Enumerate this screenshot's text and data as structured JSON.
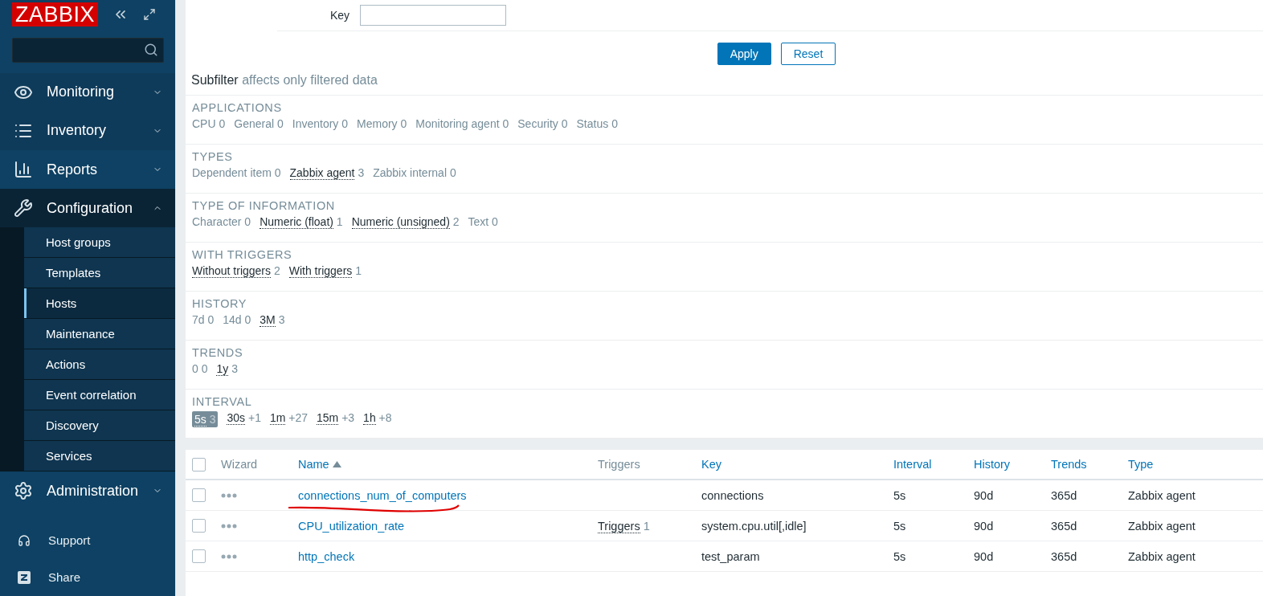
{
  "sidebar": {
    "logo": "ZABBIX",
    "menu": [
      {
        "label": "Monitoring",
        "expanded": false
      },
      {
        "label": "Inventory",
        "expanded": false
      },
      {
        "label": "Reports",
        "expanded": false
      },
      {
        "label": "Configuration",
        "expanded": true,
        "children": [
          {
            "label": "Host groups",
            "selected": false
          },
          {
            "label": "Templates",
            "selected": false
          },
          {
            "label": "Hosts",
            "selected": true
          },
          {
            "label": "Maintenance",
            "selected": false
          },
          {
            "label": "Actions",
            "selected": false
          },
          {
            "label": "Event correlation",
            "selected": false
          },
          {
            "label": "Discovery",
            "selected": false
          },
          {
            "label": "Services",
            "selected": false
          }
        ]
      },
      {
        "label": "Administration",
        "expanded": false
      }
    ],
    "footer": [
      {
        "label": "Support"
      },
      {
        "label": "Share"
      }
    ]
  },
  "filter": {
    "key_label": "Key",
    "buttons": [
      {
        "label": "Apply",
        "kind": "primary"
      },
      {
        "label": "Reset",
        "kind": "secondary"
      }
    ]
  },
  "subfilter": {
    "title": "Subfilter",
    "note": "affects only filtered data",
    "groups": [
      {
        "title": "APPLICATIONS",
        "items": [
          {
            "label": "CPU",
            "count": "0",
            "kind": "plain"
          },
          {
            "label": "General",
            "count": "0",
            "kind": "plain"
          },
          {
            "label": "Inventory",
            "count": "0",
            "kind": "plain"
          },
          {
            "label": "Memory",
            "count": "0",
            "kind": "plain"
          },
          {
            "label": "Monitoring agent",
            "count": "0",
            "kind": "plain"
          },
          {
            "label": "Security",
            "count": "0",
            "kind": "plain"
          },
          {
            "label": "Status",
            "count": "0",
            "kind": "plain"
          }
        ]
      },
      {
        "title": "TYPES",
        "items": [
          {
            "label": "Dependent item",
            "count": "0",
            "kind": "plain"
          },
          {
            "label": "Zabbix agent",
            "count": "3",
            "kind": "link"
          },
          {
            "label": "Zabbix internal",
            "count": "0",
            "kind": "plain"
          }
        ]
      },
      {
        "title": "TYPE OF INFORMATION",
        "items": [
          {
            "label": "Character",
            "count": "0",
            "kind": "plain"
          },
          {
            "label": "Numeric (float)",
            "count": "1",
            "kind": "link"
          },
          {
            "label": "Numeric (unsigned)",
            "count": "2",
            "kind": "link"
          },
          {
            "label": "Text",
            "count": "0",
            "kind": "plain"
          }
        ]
      },
      {
        "title": "WITH TRIGGERS",
        "items": [
          {
            "label": "Without triggers",
            "count": "2",
            "kind": "link"
          },
          {
            "label": "With triggers",
            "count": "1",
            "kind": "link"
          }
        ]
      },
      {
        "title": "HISTORY",
        "items": [
          {
            "label": "7d",
            "count": "0",
            "kind": "plain"
          },
          {
            "label": "14d",
            "count": "0",
            "kind": "plain"
          },
          {
            "label": "3M",
            "count": "3",
            "kind": "link"
          }
        ]
      },
      {
        "title": "TRENDS",
        "items": [
          {
            "label": "0",
            "count": "0",
            "kind": "plain"
          },
          {
            "label": "1y",
            "count": "3",
            "kind": "link"
          }
        ]
      },
      {
        "title": "INTERVAL",
        "items": [
          {
            "label": "5s",
            "count": "3",
            "kind": "active"
          },
          {
            "label": "30s",
            "count": "+1",
            "kind": "link"
          },
          {
            "label": "1m",
            "count": "+27",
            "kind": "link"
          },
          {
            "label": "15m",
            "count": "+3",
            "kind": "link"
          },
          {
            "label": "1h",
            "count": "+8",
            "kind": "link"
          }
        ]
      }
    ]
  },
  "table": {
    "select_all_checked": false,
    "columns": [
      {
        "label": "Wizard",
        "sortable": false
      },
      {
        "label": "Name",
        "sortable": true,
        "sorted": true
      },
      {
        "label": "Triggers",
        "sortable": false
      },
      {
        "label": "Key",
        "sortable": true,
        "sorted": false
      },
      {
        "label": "Interval",
        "sortable": true,
        "sorted": false
      },
      {
        "label": "History",
        "sortable": true,
        "sorted": false
      },
      {
        "label": "Trends",
        "sortable": true,
        "sorted": false
      },
      {
        "label": "Type",
        "sortable": true,
        "sorted": false
      }
    ],
    "rows": [
      {
        "checked": false,
        "name": "connections_num_of_computers",
        "annotated": true,
        "triggers": "",
        "triggers_count": "",
        "key": "connections",
        "interval": "5s",
        "history": "90d",
        "trends": "365d",
        "type": "Zabbix agent"
      },
      {
        "checked": false,
        "name": "CPU_utilization_rate",
        "triggers": "Triggers",
        "triggers_count": "1",
        "key": "system.cpu.util[,idle]",
        "interval": "5s",
        "history": "90d",
        "trends": "365d",
        "type": "Zabbix agent"
      },
      {
        "checked": false,
        "name": "http_check",
        "triggers": "",
        "triggers_count": "",
        "key": "test_param",
        "interval": "5s",
        "history": "90d",
        "trends": "365d",
        "type": "Zabbix agent"
      }
    ]
  }
}
